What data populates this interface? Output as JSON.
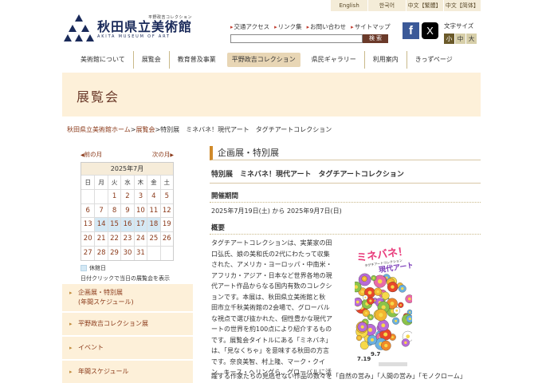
{
  "lang_bar": [
    "English",
    "한국어",
    "中文【繁體】",
    "中文【简体】"
  ],
  "logo": {
    "small": "平野政吉コレクション",
    "title": "秋田県立美術館",
    "en": "AKITA MUSEUM OF ART"
  },
  "header_links": [
    "交通アクセス",
    "リンク集",
    "お問い合わせ",
    "サイトマップ"
  ],
  "search": {
    "button": "検 索",
    "placeholder": ""
  },
  "social": {
    "facebook": "f",
    "x": "X"
  },
  "text_size": {
    "label": "文字サイズ",
    "small": "小",
    "medium": "中",
    "large": "大",
    "active": "small"
  },
  "gnav": [
    "美術館について",
    "展覧会",
    "教育普及事業",
    "平野政吉コレクション",
    "県民ギャラリー",
    "利用案内",
    "きっずページ"
  ],
  "banner_title": "展覧会",
  "breadcrumb": {
    "home": "秋田県立美術館ホーム",
    "sep": ">",
    "section": "展覧会",
    "current": ">特別展　ミネバネ！現代アート　タグチアートコレクション"
  },
  "calendar": {
    "prev": "前の月",
    "next": "次の月",
    "month": "2025年7月",
    "weekdays": [
      "日",
      "月",
      "火",
      "水",
      "木",
      "金",
      "土"
    ],
    "days": [
      "",
      "",
      "1",
      "2",
      "3",
      "4",
      "5",
      "6",
      "7",
      "8",
      "9",
      "10",
      "11",
      "12",
      "13",
      "14",
      "15",
      "16",
      "17",
      "18",
      "19",
      "20",
      "21",
      "22",
      "23",
      "24",
      "25",
      "26",
      "27",
      "28",
      "29",
      "30",
      "31",
      "",
      ""
    ],
    "holidays": [
      "14",
      "15",
      "16",
      "17",
      "18"
    ],
    "legend": "休館日",
    "note": "日付クリックで当日の展覧会を表示"
  },
  "side_menu": [
    {
      "line1": "企画展・特別展",
      "line2": "(年間スケジュール)"
    },
    {
      "line1": "平野政吉コレクション展",
      "line2": ""
    },
    {
      "line1": "イベント",
      "line2": ""
    },
    {
      "line1": "年間スケジュール",
      "line2": ""
    }
  ],
  "main": {
    "section_title": "企画展・特別展",
    "exhibition_title": "特別展　ミネバネ！現代アート　タグチアートコレクション",
    "period_heading": "開催期間",
    "period": "2025年7月19日(土) から 2025年9月7日(日)",
    "overview_heading": "概要",
    "overview_lines": [
      "タグチアートコレクションは、実業家の田",
      "口弘氏、娘の美和氏の2代にわたって収集",
      "された、アメリカ・ヨーロッパ・中南米・",
      "アフリカ・アジア・日本など世界各地の現",
      "代アート作品からなる国内有数のコレクシ",
      "ョンです。本展は、秋田県立美術館と秋",
      "田市立千秋美術館の2会場で、グローバル",
      "な視点で選び抜かれた、個性豊かな現代ア",
      "ートの世界を約100点により紹介するもの",
      "です。展覧会タイトルにある「ミネバネ」",
      "は、「見なくちゃ」を意味する秋田の方言",
      "です。奈良美智、村上隆、マーク・クイ",
      "ン、キース・ヘリングら、グローバルに活"
    ],
    "overview_cont": "躍する作家たちの見逃せない作品の数々を「自然の営み」「人間の営み」「モノクローム」",
    "poster": {
      "title": "ミネバネ！",
      "subtitle": "現代アート",
      "caption": "タグチアートコレクション",
      "date_start": "7.19",
      "date_end": "9.7"
    }
  }
}
